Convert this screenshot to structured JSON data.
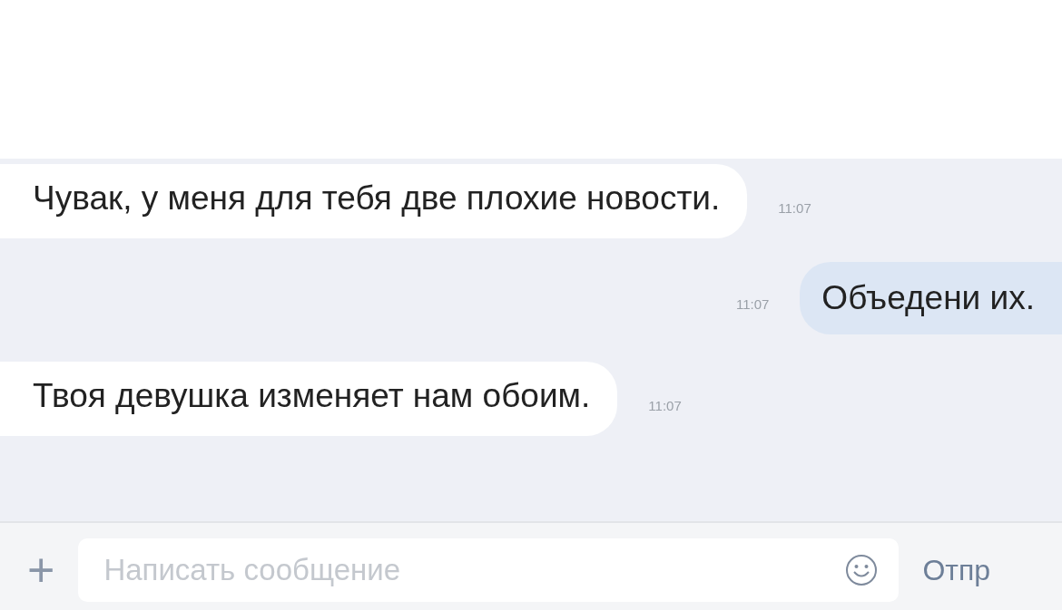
{
  "messages": [
    {
      "outgoing": false,
      "text": "Чувак, у меня для тебя две плохие новости.",
      "time": "11:07"
    },
    {
      "outgoing": true,
      "text": "Объедени их.",
      "time": "11:07"
    },
    {
      "outgoing": false,
      "text": "Твоя девушка изменяет нам обоим.",
      "time": "11:07"
    }
  ],
  "composer": {
    "add": "+",
    "placeholder": "Написать сообщение",
    "send": "Отпр"
  }
}
